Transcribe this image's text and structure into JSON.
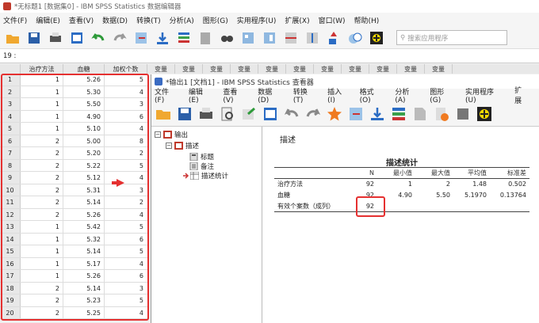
{
  "main_window": {
    "title": "*无标题1 [数据集0] - IBM SPSS Statistics 数据编辑器",
    "menu": [
      "文件(F)",
      "编辑(E)",
      "查看(V)",
      "数据(D)",
      "转换(T)",
      "分析(A)",
      "图形(G)",
      "实用程序(U)",
      "扩展(X)",
      "窗口(W)",
      "帮助(H)"
    ],
    "search_placeholder": "搜索应用程序",
    "cell_ref": "19 :",
    "columns": [
      "治疗方法",
      "血糖",
      "加权个数",
      "变量",
      "变量",
      "变量",
      "变量",
      "变量",
      "变量",
      "变量",
      "变量",
      "变量",
      "变量",
      "变量"
    ],
    "rows": [
      {
        "n": "1",
        "a": "1",
        "b": "5.26",
        "c": "5"
      },
      {
        "n": "2",
        "a": "1",
        "b": "5.30",
        "c": "4"
      },
      {
        "n": "3",
        "a": "1",
        "b": "5.50",
        "c": "3"
      },
      {
        "n": "4",
        "a": "1",
        "b": "4.90",
        "c": "6"
      },
      {
        "n": "5",
        "a": "1",
        "b": "5.10",
        "c": "4"
      },
      {
        "n": "6",
        "a": "2",
        "b": "5.00",
        "c": "8"
      },
      {
        "n": "7",
        "a": "2",
        "b": "5.20",
        "c": "2"
      },
      {
        "n": "8",
        "a": "2",
        "b": "5.22",
        "c": "5"
      },
      {
        "n": "9",
        "a": "2",
        "b": "5.12",
        "c": "4"
      },
      {
        "n": "10",
        "a": "2",
        "b": "5.31",
        "c": "3"
      },
      {
        "n": "11",
        "a": "2",
        "b": "5.14",
        "c": "2"
      },
      {
        "n": "12",
        "a": "2",
        "b": "5.26",
        "c": "4"
      },
      {
        "n": "13",
        "a": "1",
        "b": "5.42",
        "c": "5"
      },
      {
        "n": "14",
        "a": "1",
        "b": "5.32",
        "c": "6"
      },
      {
        "n": "15",
        "a": "1",
        "b": "5.14",
        "c": "5"
      },
      {
        "n": "16",
        "a": "1",
        "b": "5.17",
        "c": "4"
      },
      {
        "n": "17",
        "a": "1",
        "b": "5.26",
        "c": "6"
      },
      {
        "n": "18",
        "a": "2",
        "b": "5.14",
        "c": "3"
      },
      {
        "n": "19",
        "a": "2",
        "b": "5.23",
        "c": "5"
      },
      {
        "n": "20",
        "a": "2",
        "b": "5.25",
        "c": "4"
      }
    ]
  },
  "viewer": {
    "title": "*输出1 [文档1] - IBM SPSS Statistics 查看器",
    "menu": [
      "文件(F)",
      "编辑(E)",
      "查看(V)",
      "数据(D)",
      "转换(T)",
      "插入(I)",
      "格式(O)",
      "分析(A)",
      "图形(G)",
      "实用程序(U)",
      "扩展"
    ],
    "outline": {
      "output": "输出",
      "descriptives": "描述",
      "title": "标题",
      "notes": "备注",
      "stats": "描述统计"
    },
    "heading": "描述",
    "table_title": "描述统计",
    "table_headers": [
      "",
      "N",
      "最小值",
      "最大值",
      "平均值",
      "标准差"
    ],
    "table_rows": [
      {
        "label": "治疗方法",
        "n": "92",
        "min": "1",
        "max": "2",
        "mean": "1.48",
        "sd": "0.502"
      },
      {
        "label": "血糖",
        "n": "92",
        "min": "4.90",
        "max": "5.50",
        "mean": "5.1970",
        "sd": "0.13764"
      },
      {
        "label": "有效个案数（成列）",
        "n": "92",
        "min": "",
        "max": "",
        "mean": "",
        "sd": ""
      }
    ]
  },
  "colors": {
    "highlight_red": "#e53030",
    "accent_blue": "#3a6bc2"
  }
}
